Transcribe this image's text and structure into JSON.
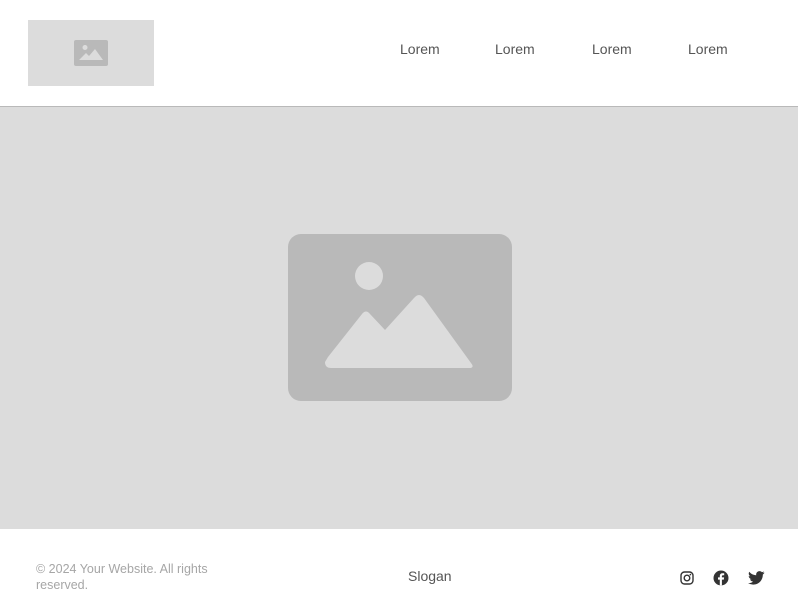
{
  "header": {
    "logo_icon": "image-placeholder-icon",
    "nav": [
      {
        "label": "Lorem"
      },
      {
        "label": "Lorem"
      },
      {
        "label": "Lorem"
      },
      {
        "label": "Lorem"
      }
    ]
  },
  "hero": {
    "image_icon": "image-placeholder-icon"
  },
  "footer": {
    "copyright": "© 2024 Your Website. All rights reserved.",
    "slogan": "Slogan",
    "social": [
      {
        "icon": "instagram-icon"
      },
      {
        "icon": "facebook-icon"
      },
      {
        "icon": "twitter-icon"
      }
    ]
  },
  "colors": {
    "placeholder_bg": "#dcdcdc",
    "placeholder_icon": "#b9b9b9",
    "nav_text": "#555555",
    "muted_text": "#a6a6a6",
    "icon_dark": "#333333"
  }
}
